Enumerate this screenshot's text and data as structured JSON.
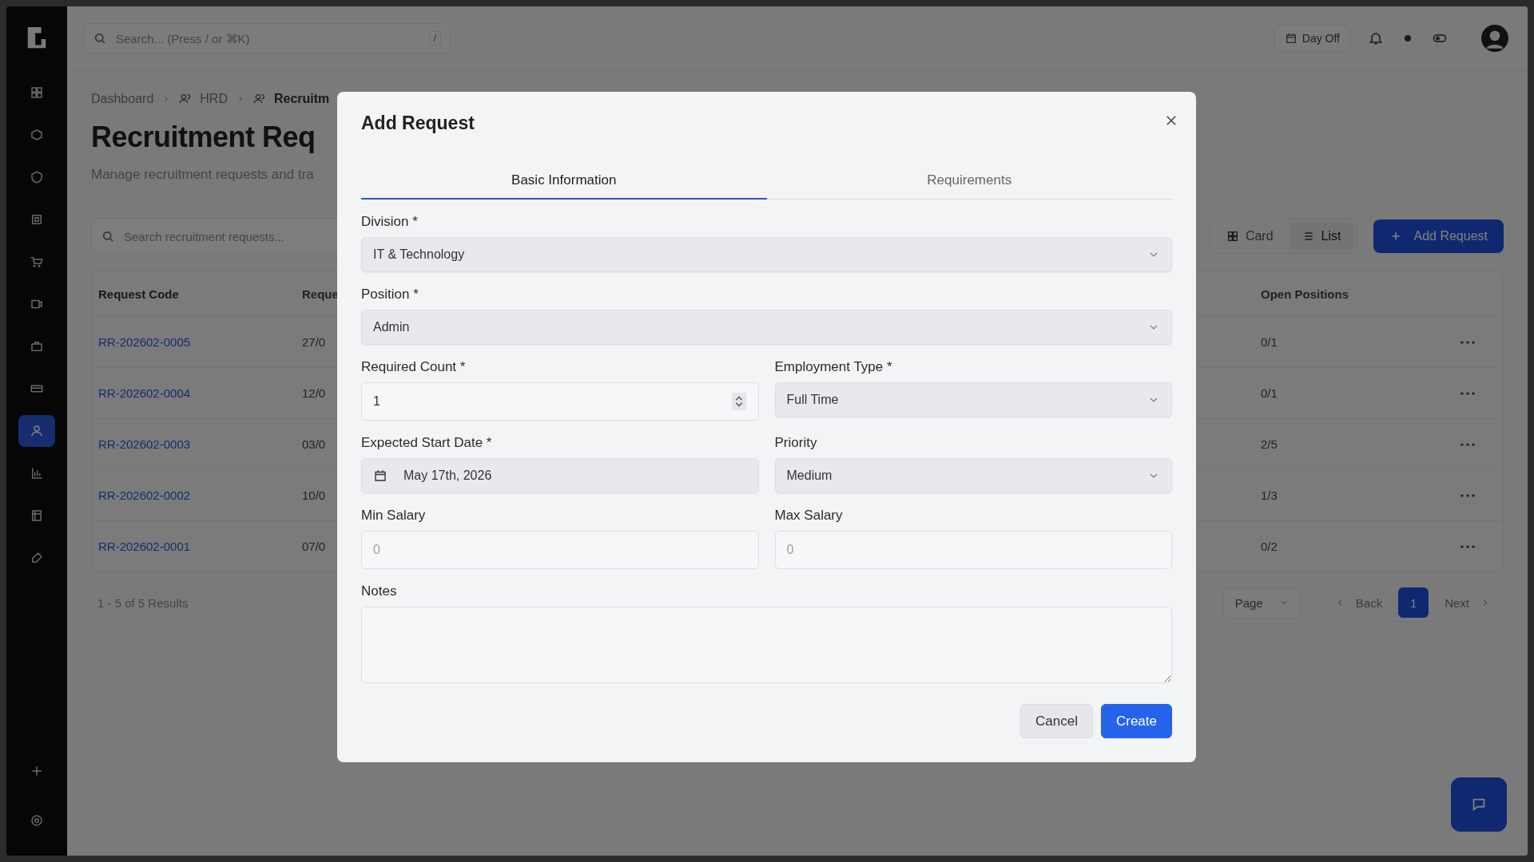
{
  "sidebar": {
    "items": [
      {
        "selected": false
      },
      {
        "selected": false
      },
      {
        "selected": false
      },
      {
        "selected": false
      },
      {
        "selected": false
      },
      {
        "selected": false
      },
      {
        "selected": false
      },
      {
        "selected": false
      },
      {
        "selected": true
      },
      {
        "selected": false
      },
      {
        "selected": false
      },
      {
        "selected": false
      }
    ],
    "bottom_items": [
      {
        "selected": false
      },
      {
        "selected": false
      }
    ]
  },
  "header": {
    "search": {
      "placeholder": "Search... (Press / or ⌘K)",
      "shortcut": "/"
    },
    "day_off": "Day Off"
  },
  "breadcrumb": [
    "Dashboard",
    "HRD",
    "Recruitm"
  ],
  "page": {
    "title": "Recruitment Req",
    "subtitle": "Manage recruitment requests and tra"
  },
  "toolbar": {
    "search": {
      "placeholder": "Search recruitment requests..."
    },
    "views": [
      {
        "label": "Card",
        "selected": false
      },
      {
        "label": "List",
        "selected": true
      }
    ],
    "add_button": "Add Request"
  },
  "table": {
    "columns": [
      "Request Code",
      "Reque",
      "Open Positions"
    ],
    "rows": [
      {
        "code": "RR-202602-0005",
        "column_2": "27/0",
        "open": "0/1"
      },
      {
        "code": "RR-202602-0004",
        "column_2": "12/0",
        "open": "0/1"
      },
      {
        "code": "RR-202602-0003",
        "column_2": "03/0",
        "open": "2/5"
      },
      {
        "code": "RR-202602-0002",
        "column_2": "10/0",
        "open": "1/3"
      },
      {
        "code": "RR-202602-0001",
        "column_2": "07/0",
        "open": "0/2"
      }
    ],
    "results": "1 - 5 of 5 Results",
    "pagination": {
      "per_page": "Page",
      "back": "Back",
      "pages": [
        {
          "label": "1",
          "selected": true
        }
      ],
      "next": "Next"
    }
  },
  "modal": {
    "title": "Add Request",
    "tabs": [
      {
        "label": "Basic Information",
        "selected": true
      },
      {
        "label": "Requirements",
        "selected": false
      }
    ],
    "rows": [
      [
        {
          "label": "Division *",
          "kind": "select",
          "value": "IT & Technology"
        }
      ],
      [
        {
          "label": "Position *",
          "kind": "select",
          "value": "Admin"
        }
      ],
      [
        {
          "label": "Required Count *",
          "kind": "number",
          "value": "1"
        },
        {
          "label": "Employment Type *",
          "kind": "select",
          "value": "Full Time"
        }
      ],
      [
        {
          "label": "Expected Start Date *",
          "kind": "date",
          "value": "May 17th, 2026"
        },
        {
          "label": "Priority",
          "kind": "select",
          "value": "Medium"
        }
      ],
      [
        {
          "label": "Min Salary",
          "kind": "text",
          "placeholder": "0"
        },
        {
          "label": "Max Salary",
          "kind": "text",
          "placeholder": "0"
        }
      ],
      [
        {
          "label": "Notes",
          "kind": "textarea"
        }
      ]
    ],
    "buttons": [
      {
        "label": "Cancel",
        "kind": "secondary"
      },
      {
        "label": "Create",
        "kind": "primary"
      }
    ]
  }
}
